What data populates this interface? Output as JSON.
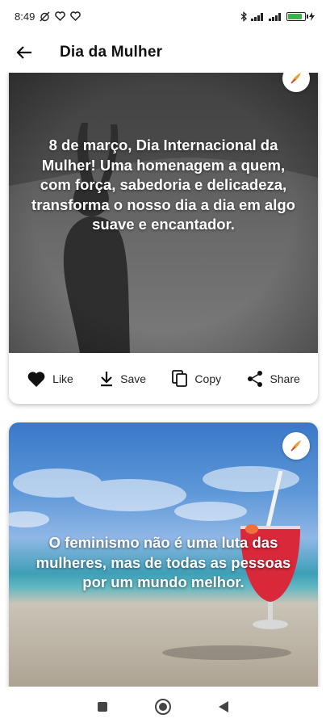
{
  "status_bar": {
    "time": "8:49",
    "battery_level": 0.85
  },
  "header": {
    "title": "Dia da Mulher",
    "back_icon": "arrow-left-icon"
  },
  "cards": [
    {
      "quote": "8 de março, Dia Internacional da Mulher! Uma homenagem a quem, com força, sabedoria e delicadeza, transforma o nosso dia a dia em algo suave e encantador.",
      "actions": {
        "like": "Like",
        "save": "Save",
        "copy": "Copy",
        "share": "Share"
      }
    },
    {
      "quote": "O feminismo não é uma luta das mulheres, mas de todas as pessoas por um mundo melhor."
    }
  ],
  "colors": {
    "battery_green": "#3bb44a",
    "badge_orange": "#e8a23a",
    "badge_red": "#d9442c",
    "drink_red": "#d8283a"
  },
  "nav": {
    "recent_icon": "square-icon",
    "home_icon": "circle-icon",
    "back_icon": "triangle-back-icon"
  }
}
